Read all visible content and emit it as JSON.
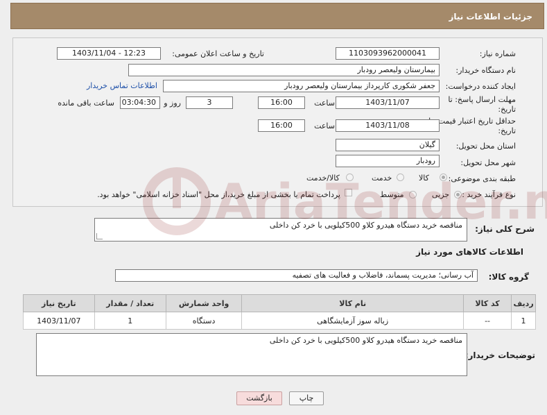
{
  "header": {
    "title": "جزئیات اطلاعات نیاز"
  },
  "form": {
    "need_number_label": "شماره نیاز:",
    "need_number": "1103093962000041",
    "announce_label": "تاریخ و ساعت اعلان عمومی:",
    "announce_value": "1403/11/04 - 12:23",
    "buyer_org_label": "نام دستگاه خریدار:",
    "buyer_org": "بیمارستان ولیعصر رودبار",
    "creator_label": "ایجاد کننده درخواست:",
    "creator": "جعفر شکوری کارپرداز بیمارستان ولیعصر رودبار",
    "contact_link": "اطلاعات تماس خریدار",
    "reply_deadline_label": "مهلت ارسال پاسخ: تا",
    "reply_deadline_label2": "تاریخ:",
    "reply_date": "1403/11/07",
    "time_label": "ساعت",
    "reply_time": "16:00",
    "days": "3",
    "days_label": "روز و",
    "remaining": "03:04:30",
    "remaining_label": "ساعت باقی مانده",
    "validity_label": "حداقل تاریخ اعتبار قیمت: تا",
    "validity_label2": "تاریخ:",
    "validity_date": "1403/11/08",
    "validity_time": "16:00",
    "province_label": "استان محل تحویل:",
    "province": "گیلان",
    "city_label": "شهر محل تحویل:",
    "city": "رودبار",
    "category_label": "طبقه بندی موضوعی:",
    "category_options": [
      "کالا",
      "خدمت",
      "کالا/خدمت"
    ],
    "process_label": "نوع فرآیند خرید :",
    "process_options": [
      "جزیی",
      "متوسط"
    ],
    "payment_note": "پرداخت تمام یا بخشی از مبلغ خرید،از محل \"اسناد خزانه اسلامی\" خواهد بود."
  },
  "description": {
    "label": "شرح کلی نیاز:",
    "value": "مناقصه خرید دستگاه هیدرو کلاو 500کیلویی با خرد کن داخلی"
  },
  "goods": {
    "section_title": "اطلاعات کالاهای مورد نیاز",
    "group_label": "گروه کالا:",
    "group_value": "آب رسانی؛ مدیریت پسماند، فاضلاب و فعالیت های تصفیه",
    "headers": [
      "ردیف",
      "کد کالا",
      "نام کالا",
      "واحد شمارش",
      "تعداد / مقدار",
      "تاریخ نیاز"
    ],
    "rows": [
      {
        "row": "1",
        "code": "--",
        "name": "زباله سوز آزمایشگاهی",
        "unit": "دستگاه",
        "qty": "1",
        "date": "1403/11/07"
      }
    ]
  },
  "buyer_notes": {
    "label": "توضیحات خریدار:",
    "value": "مناقصه خرید دستگاه هیدرو کلاو 500کیلویی با خرد کن داخلی"
  },
  "buttons": {
    "print": "چاپ",
    "back": "بازگشت"
  },
  "watermark": {
    "text": "AriaTender.neT"
  }
}
